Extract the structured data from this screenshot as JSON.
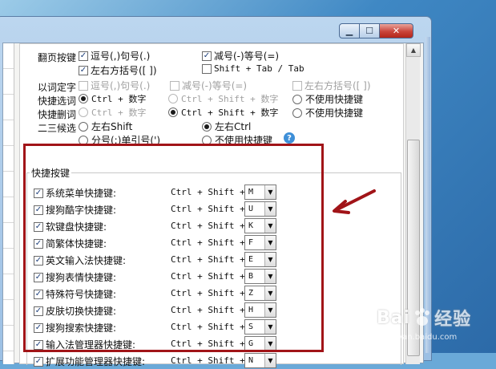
{
  "window": {
    "min_glyph": "▁",
    "max_glyph": "☐",
    "close_glyph": "✕"
  },
  "options": {
    "flip_key": {
      "label": "翻页按键",
      "comma_period": "逗号(,)句号(.)",
      "minus_equal": "减号(-)等号(=)",
      "brackets": "左右方括号([ ])",
      "shift_tab": "Shift + Tab / Tab"
    },
    "word_select": {
      "label": "以词定字",
      "comma_period": "逗号(,)句号(.)",
      "minus_equal": "减号(-)等号(=)",
      "brackets": "左右方括号([ ])"
    },
    "quick_select": {
      "label": "快捷选词",
      "ctrl_num": "Ctrl + 数字",
      "ctrl_shift_num": "Ctrl + Shift + 数字",
      "none": "不使用快捷键"
    },
    "quick_delete": {
      "label": "快捷删词",
      "ctrl_num": "Ctrl + 数字",
      "ctrl_shift_num": "Ctrl + Shift + 数字",
      "none": "不使用快捷键"
    },
    "second_candidate": {
      "label": "二三候选",
      "left_shift": "左右Shift",
      "left_ctrl": "左右Ctrl",
      "semicolon_quote": "分号(;)单引号(')",
      "none": "不使用快捷键",
      "help_glyph": "?"
    }
  },
  "hotkeys": {
    "group_title": "快捷按键",
    "items": [
      {
        "name": "系统菜单快捷键:",
        "keys": "Ctrl + Shift +",
        "key": "M"
      },
      {
        "name": "搜狗酷字快捷键:",
        "keys": "Ctrl + Shift +",
        "key": "U"
      },
      {
        "name": "软键盘快捷键:",
        "keys": "Ctrl + Shift +",
        "key": "K"
      },
      {
        "name": "简繁体快捷键:",
        "keys": "Ctrl + Shift +",
        "key": "F"
      },
      {
        "name": "英文输入法快捷键:",
        "keys": "Ctrl + Shift +",
        "key": "E"
      },
      {
        "name": "搜狗表情快捷键:",
        "keys": "Ctrl + Shift +",
        "key": "B"
      },
      {
        "name": "特殊符号快捷键:",
        "keys": "Ctrl + Shift +",
        "key": "Z"
      },
      {
        "name": "皮肤切换快捷键:",
        "keys": "Ctrl + Shift +",
        "key": "H"
      },
      {
        "name": "搜狗搜索快捷键:",
        "keys": "Ctrl + Shift +",
        "key": "S"
      },
      {
        "name": "输入法管理器快捷键:",
        "keys": "Ctrl + Shift +",
        "key": "G"
      },
      {
        "name": "扩展功能管理器快捷键:",
        "keys": "Ctrl + Shift +",
        "key": "N"
      }
    ],
    "check_glyph": "✓",
    "dropdown_glyph": "▼"
  },
  "scrollbar": {
    "up_glyph": "▲",
    "down_glyph": "▼"
  },
  "watermark": {
    "brand": "Bai",
    "brand2": "经验",
    "sub": "jingyan.baidu.com"
  },
  "colors": {
    "annotation": "#a11418",
    "help": "#3e8fd8"
  }
}
